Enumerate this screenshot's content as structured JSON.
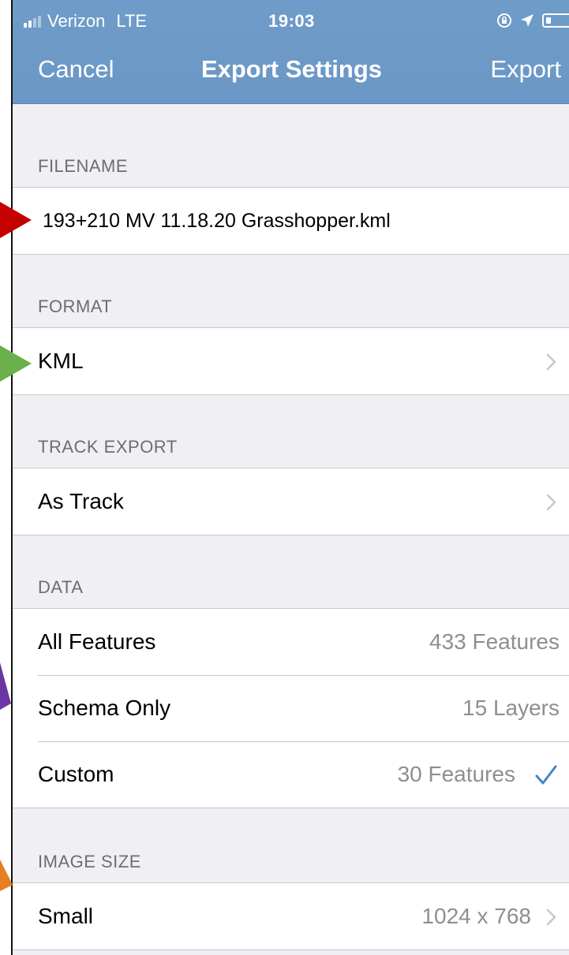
{
  "status_bar": {
    "carrier": "Verizon",
    "network": "LTE",
    "time": "19:03"
  },
  "nav": {
    "cancel_label": "Cancel",
    "title": "Export Settings",
    "export_label": "Export"
  },
  "sections": {
    "filename": {
      "header": "FILENAME",
      "value": "193+210 MV 11.18.20 Grasshopper.kml"
    },
    "format": {
      "header": "FORMAT",
      "value": "KML"
    },
    "track_export": {
      "header": "TRACK EXPORT",
      "value": "As Track"
    },
    "data": {
      "header": "DATA",
      "rows": [
        {
          "label": "All Features",
          "value": "433 Features",
          "selected": false
        },
        {
          "label": "Schema Only",
          "value": "15 Layers",
          "selected": false
        },
        {
          "label": "Custom",
          "value": "30 Features",
          "selected": true
        }
      ]
    },
    "image_size": {
      "header": "IMAGE SIZE",
      "label": "Small",
      "value": "1024 x 768"
    }
  },
  "colors": {
    "nav_bar": "#6f9cc8",
    "accent_check": "#4a84c4",
    "background": "#efeff4",
    "arrow_red": "#c40000",
    "arrow_green": "#6ab04c",
    "arrow_purple": "#6b35a6",
    "arrow_orange": "#e67e22"
  },
  "icons": {
    "signal": "signal-bars-icon",
    "orientation_lock": "orientation-lock-icon",
    "location": "location-arrow-icon",
    "battery": "battery-icon",
    "disclosure": "chevron-right-icon",
    "selected": "checkmark-icon"
  }
}
